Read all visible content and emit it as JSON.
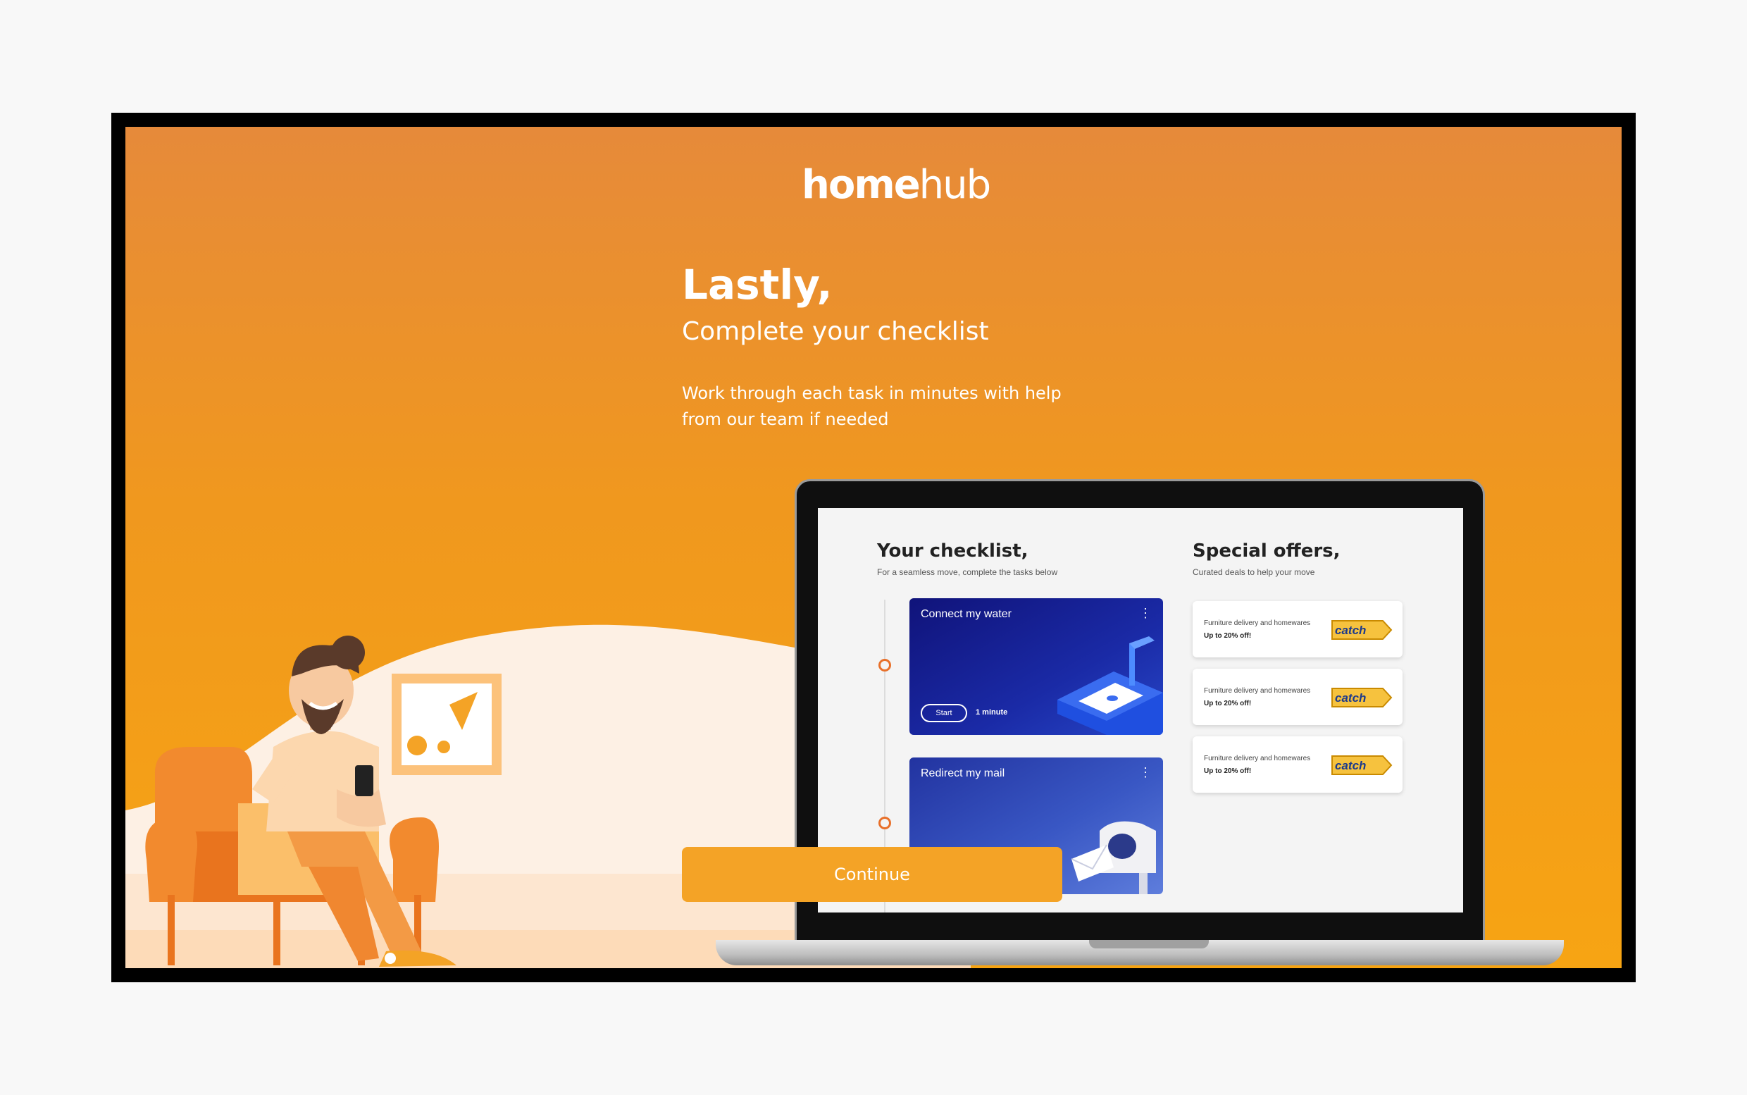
{
  "brand": {
    "home": "home",
    "hub": "hub"
  },
  "intro": {
    "title": "Lastly,",
    "subtitle": "Complete your checklist",
    "description": "Work through each task in minutes with help from our team if needed"
  },
  "laptop": {
    "checklist": {
      "title": "Your checklist,",
      "subtitle": "For a seamless move, complete the tasks below",
      "tasks": [
        {
          "label": "Connect my water",
          "start_label": "Start",
          "time": "1 minute",
          "icon": "water-tap-icon"
        },
        {
          "label": "Redirect my mail",
          "icon": "mailbox-icon"
        }
      ]
    },
    "offers": {
      "title": "Special offers,",
      "subtitle": "Curated deals to help your move",
      "items": [
        {
          "line1": "Furniture delivery and homewares",
          "line2": "Up to 20% off!",
          "logo_text": "catch"
        },
        {
          "line1": "Furniture delivery and homewares",
          "line2": "Up to 20% off!",
          "logo_text": "catch"
        },
        {
          "line1": "Furniture delivery and homewares",
          "line2": "Up to 20% off!",
          "logo_text": "catch"
        }
      ]
    }
  },
  "continue_label": "Continue",
  "colors": {
    "accent": "#f4a326",
    "brand_orange": "#e8702a",
    "task_blue": "#1a2aa6"
  }
}
